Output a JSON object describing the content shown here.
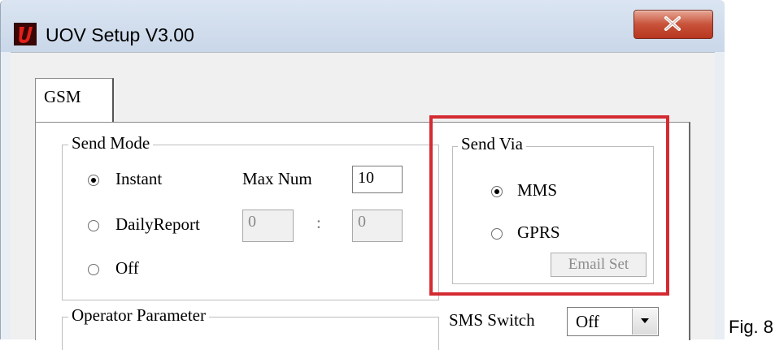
{
  "window": {
    "title": "UOV Setup V3.00",
    "app_icon": "uov-logo-icon",
    "close_icon": "close-icon"
  },
  "tabs": [
    {
      "label": "GSM",
      "selected": true
    }
  ],
  "send_mode": {
    "title": "Send Mode",
    "options": [
      {
        "label": "Instant",
        "checked": true
      },
      {
        "label": "DailyReport",
        "checked": false
      },
      {
        "label": "Off",
        "checked": false
      }
    ],
    "max_num_label": "Max Num",
    "max_num_value": "10",
    "daily_hour": "0",
    "separator": ":",
    "daily_minute": "0"
  },
  "send_via": {
    "title": "Send Via",
    "options": [
      {
        "label": "MMS",
        "checked": true
      },
      {
        "label": "GPRS",
        "checked": false
      }
    ],
    "email_button": "Email Set",
    "highlight_color": "#d42a32"
  },
  "operator_parameter": {
    "title": "Operator Parameter"
  },
  "sms_switch": {
    "label": "SMS Switch",
    "value": "Off",
    "arrow_icon": "dropdown-arrow-icon"
  },
  "caption": "Fig. 8"
}
